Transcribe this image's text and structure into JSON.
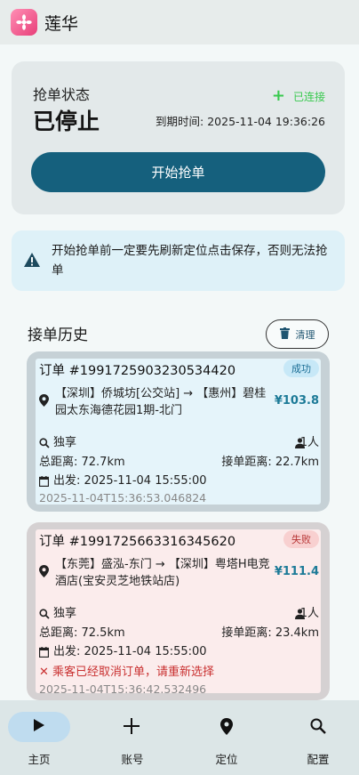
{
  "app": {
    "title": "莲华",
    "logo_icon": "lotus-icon"
  },
  "status": {
    "label": "抢单状态",
    "value": "已停止",
    "connection": "已连接",
    "expire": "到期时间: 2025-11-04 19:36:26",
    "start_button": "开始抢单"
  },
  "warning": {
    "text": "开始抢单前一定要先刷新定位点击保存，否则无法抢单"
  },
  "history": {
    "title": "接单历史",
    "clear_button": "清理",
    "orders": [
      {
        "id": "订单 #1991725903230534420",
        "status": "成功",
        "route": "【深圳】侨城坊[公交站] → 【惠州】碧桂园太东海德花园1期-北门",
        "price": "¥103.8",
        "mode": "独享",
        "people": "1人",
        "total_distance": "总距离: 72.7km",
        "pickup_distance": "接单距离: 22.7km",
        "depart": "出发: 2025-11-04 15:55:00",
        "timestamp": "2025-11-04T15:36:53.046824"
      },
      {
        "id": "订单 #1991725663316345620",
        "status": "失败",
        "route": "【东莞】盛泓-东门 → 【深圳】粤塔H电竞酒店(宝安灵芝地铁站店)",
        "price": "¥111.4",
        "mode": "独享",
        "people": "1人",
        "total_distance": "总距离: 72.5km",
        "pickup_distance": "接单距离: 23.4km",
        "depart": "出发: 2025-11-04 15:55:00",
        "cancel_reason": "✕ 乘客已经取消订单，请重新选择",
        "timestamp": "2025-11-04T15:36:42.532496"
      }
    ]
  },
  "nav": {
    "items": [
      {
        "label": "主页",
        "icon": "play-icon",
        "active": true
      },
      {
        "label": "账号",
        "icon": "plus-icon",
        "active": false
      },
      {
        "label": "定位",
        "icon": "location-pin-icon",
        "active": false
      },
      {
        "label": "配置",
        "icon": "search-icon",
        "active": false
      }
    ]
  },
  "colors": {
    "accent": "#15607d",
    "connected": "#38c94e",
    "price": "#1c7a97",
    "error": "#c93030"
  }
}
